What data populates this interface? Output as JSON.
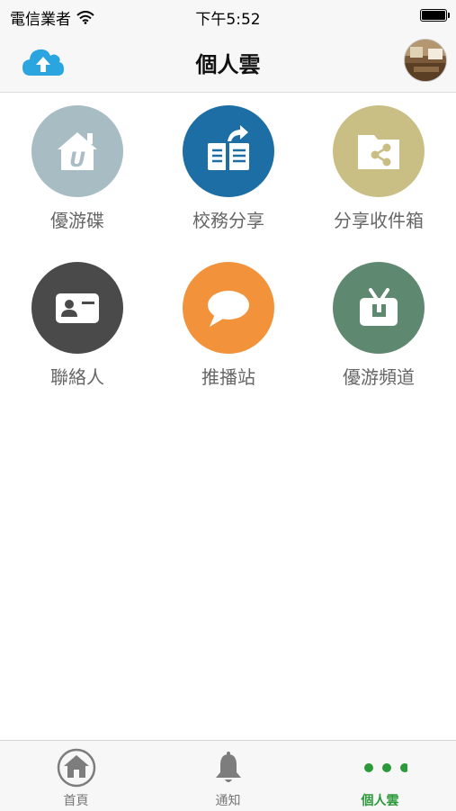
{
  "status": {
    "carrier": "電信業者",
    "time": "下午5:52"
  },
  "header": {
    "title": "個人雲",
    "upload_icon": "cloud-upload-icon",
    "avatar_icon": "user-avatar"
  },
  "apps": [
    {
      "label": "優游碟",
      "icon": "home-u-icon",
      "color": "#a8bcc4"
    },
    {
      "label": "校務分享",
      "icon": "newspaper-share-icon",
      "color": "#1c6ea4"
    },
    {
      "label": "分享收件箱",
      "icon": "folder-share-icon",
      "color": "#c9bf84"
    },
    {
      "label": "聯絡人",
      "icon": "contact-card-icon",
      "color": "#4a4a4a"
    },
    {
      "label": "推播站",
      "icon": "chat-bubble-icon",
      "color": "#f2923a"
    },
    {
      "label": "優游頻道",
      "icon": "tv-u-icon",
      "color": "#5f8870"
    }
  ],
  "tabs": [
    {
      "label": "首頁",
      "icon": "home-icon",
      "active": false
    },
    {
      "label": "通知",
      "icon": "bell-icon",
      "active": false
    },
    {
      "label": "個人雲",
      "icon": "more-dots-icon",
      "active": true
    }
  ],
  "colors": {
    "accent": "#2c9a3a",
    "cloud": "#2aa5e0",
    "tab_inactive": "#777777"
  }
}
